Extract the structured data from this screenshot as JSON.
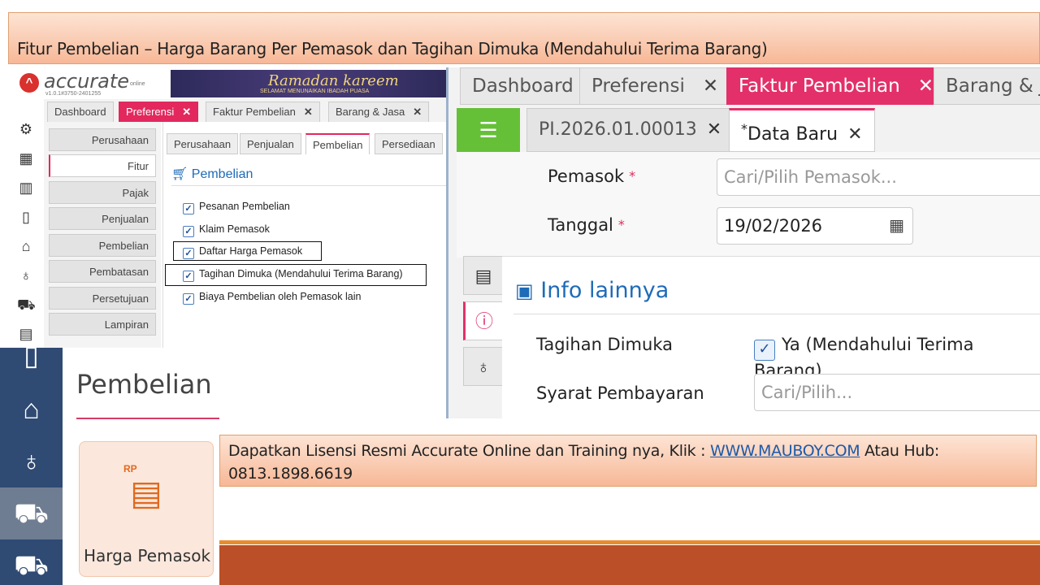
{
  "title": "Fitur Pembelian – Harga Barang Per Pemasok dan Tagihan Dimuka (Mendahului Terima Barang)",
  "screen1": {
    "logo": "accurate",
    "logo_sub": "online",
    "version": "v1.0.1#3750-2401255",
    "banner_text": "Ramadan kareem",
    "banner_sub": "SELAMAT MENUNAIKAN IBADAH PUASA",
    "tabs": [
      {
        "label": "Dashboard",
        "closable": false
      },
      {
        "label": "Preferensi",
        "closable": true,
        "active": true
      },
      {
        "label": "Faktur Pembelian",
        "closable": true
      },
      {
        "label": "Barang & Jasa",
        "closable": true
      }
    ],
    "left_nav": [
      "Perusahaan",
      "Fitur",
      "Pajak",
      "Penjualan",
      "Pembelian",
      "Pembatasan",
      "Persetujuan",
      "Lampiran"
    ],
    "subtabs": [
      "Perusahaan",
      "Penjualan",
      "Pembelian",
      "Persediaan"
    ],
    "section_title": "Pembelian",
    "checkboxes": [
      {
        "label": "Pesanan Pembelian",
        "checked": true
      },
      {
        "label": "Klaim Pemasok",
        "checked": true
      },
      {
        "label": "Daftar Harga Pemasok",
        "checked": true
      },
      {
        "label": "Tagihan Dimuka (Mendahului Terima Barang)",
        "checked": true
      },
      {
        "label": "Biaya Pembelian oleh Pemasok lain",
        "checked": true
      }
    ]
  },
  "screen2": {
    "tabs": [
      {
        "label": "Dashboard"
      },
      {
        "label": "Preferensi"
      },
      {
        "label": "Faktur Pembelian",
        "active": true
      },
      {
        "label": "Barang & Ja"
      }
    ],
    "subtabs": [
      {
        "label": "PI.2026.01.00013"
      },
      {
        "label": "Data Baru",
        "prefix": "*",
        "active": true
      }
    ],
    "pemasok_label": "Pemasok",
    "pemasok_placeholder": "Cari/Pilih Pemasok...",
    "tanggal_label": "Tanggal",
    "tanggal_value": "19/02/2026",
    "required_mark": "*",
    "info_title": "Info lainnya",
    "tagihan_label": "Tagihan Dimuka",
    "tagihan_value": "Ya (Mendahului Terima Barang)",
    "syarat_label": "Syarat Pembayaran",
    "syarat_placeholder": "Cari/Pilih..."
  },
  "screen3": {
    "title": "Pembelian",
    "tile_label": "Harga Pemasok",
    "tile_icon_text": "RP"
  },
  "cta": {
    "prefix": "Dapatkan Lisensi Resmi Accurate Online dan Training nya, Klik : ",
    "link": "WWW.MAUBOY.COM",
    "suffix": " Atau Hub: 0813.1898.6619"
  }
}
